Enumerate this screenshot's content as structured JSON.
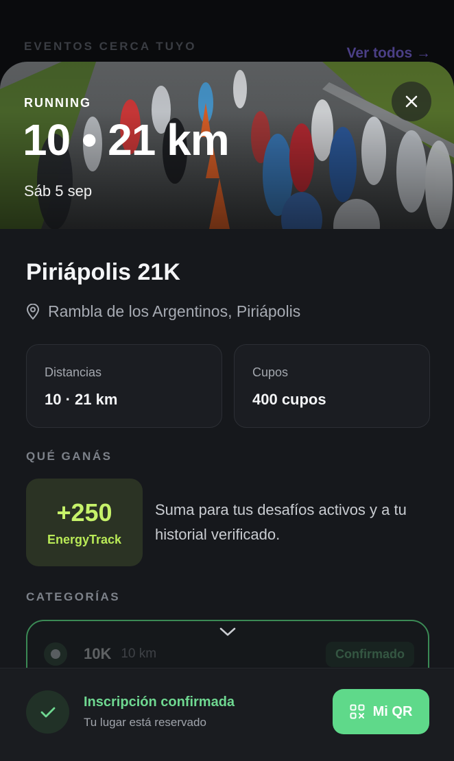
{
  "background": {
    "section_title": "EVENTOS CERCA TUYO",
    "see_all_label": "Ver todos →"
  },
  "hero": {
    "sport_tag": "RUNNING",
    "distances_title": "10 • 21 km",
    "date": "Sáb 5 sep",
    "close_icon": "close-icon"
  },
  "event": {
    "name": "Piriápolis 21K",
    "location": "Rambla de los Argentinos, Piriápolis",
    "location_icon": "map-pin-icon"
  },
  "stats": [
    {
      "label": "Distancias",
      "value": "10 · 21 km"
    },
    {
      "label": "Cupos",
      "value": "400 cupos"
    }
  ],
  "rewards": {
    "section_title": "QUÉ GANÁS",
    "points": "+250",
    "brand": "EnergyTrack",
    "description": "Suma para tus desafíos activos y a tu historial verificado."
  },
  "categories": {
    "section_title": "CATEGORÍAS",
    "items": [
      {
        "name": "10K",
        "distance": "10 km",
        "status": "Confirmado"
      }
    ]
  },
  "footer": {
    "status_title": "Inscripción confirmada",
    "status_subtitle": "Tu lugar está reservado",
    "qr_button_label": "Mi QR"
  },
  "colors": {
    "accent_green": "#5fd98a",
    "reward_lime": "#c6f26a",
    "link_purple": "#4b3f86",
    "sheet_bg": "#16181c"
  }
}
